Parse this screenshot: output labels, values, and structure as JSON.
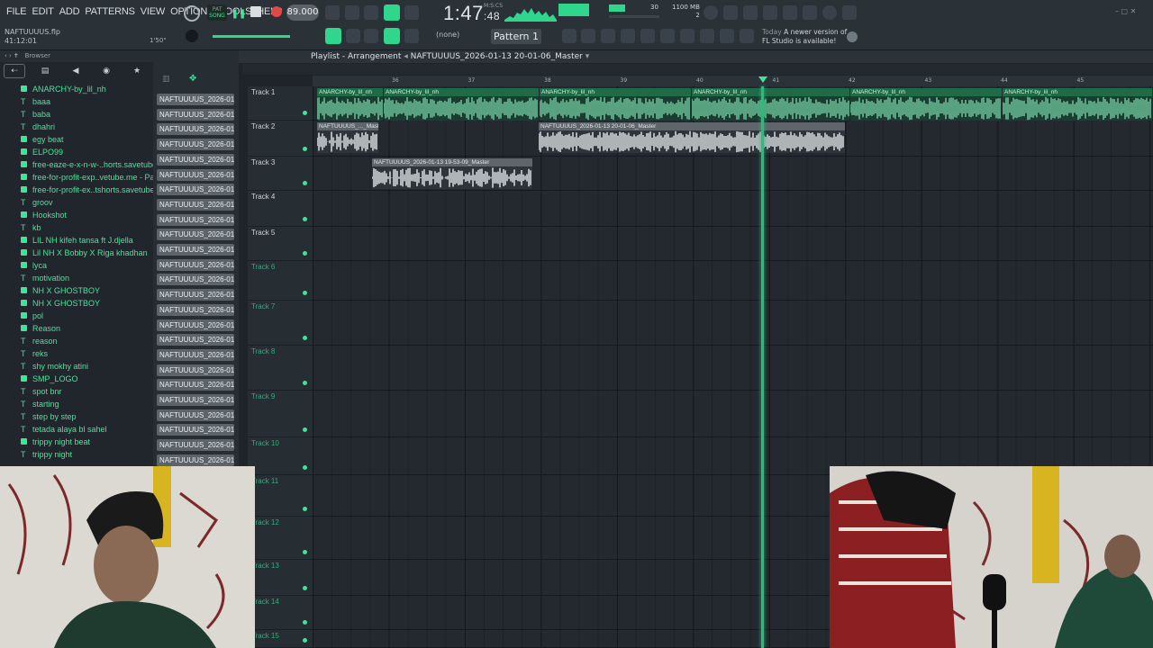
{
  "menu": [
    "FILE",
    "EDIT",
    "ADD",
    "PATTERNS",
    "VIEW",
    "OPTIONS",
    "TOOLS",
    "HELP"
  ],
  "project": {
    "filename": "NAFTUUUUS.flp",
    "time": "41:12:01",
    "zoom": "1'50\""
  },
  "transport": {
    "mode_label": "SONG",
    "tempo": "89.000",
    "time_main": "1:47",
    "time_sub": "48",
    "time_unit": "M:S:CS"
  },
  "cpu": {
    "memory": "1100 MB",
    "polyphony": "2",
    "cpu_value": "30"
  },
  "pattern": {
    "channel": "(none)",
    "name": "Pattern 1"
  },
  "news": {
    "when": "Today",
    "message_line1": "A newer version of",
    "message_line2": "FL Studio is available!"
  },
  "browser": {
    "title": "Browser",
    "items": [
      {
        "label": "ANARCHY-by_lil_nh",
        "type": "folder"
      },
      {
        "label": "baaa",
        "type": "text"
      },
      {
        "label": "baba",
        "type": "text"
      },
      {
        "label": "dhahri",
        "type": "text"
      },
      {
        "label": "egy beat",
        "type": "folder"
      },
      {
        "label": "ELPO99",
        "type": "folder"
      },
      {
        "label": "free-eaze-e-x-n-w-..horts.savetube.me",
        "type": "folder"
      },
      {
        "label": "free-for-profit-exp..vetube.me - Part_2",
        "type": "folder"
      },
      {
        "label": "free-for-profit-ex..tshorts.savetube.me",
        "type": "folder"
      },
      {
        "label": "groov",
        "type": "text"
      },
      {
        "label": "Hookshot",
        "type": "folder"
      },
      {
        "label": "kb",
        "type": "text"
      },
      {
        "label": "LIL NH kifeh tansa ft J.djella",
        "type": "folder"
      },
      {
        "label": "Lil NH X Bobby X Riga khadhan",
        "type": "folder"
      },
      {
        "label": "lyca",
        "type": "folder"
      },
      {
        "label": "motivation",
        "type": "text"
      },
      {
        "label": "NH X GHOSTBOY",
        "type": "folder"
      },
      {
        "label": "NH X GHOSTBOY",
        "type": "folder"
      },
      {
        "label": "pol",
        "type": "folder"
      },
      {
        "label": "Reason",
        "type": "folder"
      },
      {
        "label": "reason",
        "type": "text"
      },
      {
        "label": "reks",
        "type": "text"
      },
      {
        "label": "shy mokhy atini",
        "type": "text"
      },
      {
        "label": "SMP_LOGO",
        "type": "folder"
      },
      {
        "label": "spot bnr",
        "type": "text"
      },
      {
        "label": "starting",
        "type": "text"
      },
      {
        "label": "step by step",
        "type": "text"
      },
      {
        "label": "tetada alaya bl sahel",
        "type": "text"
      },
      {
        "label": "trippy night beat",
        "type": "folder"
      },
      {
        "label": "trippy night",
        "type": "text"
      }
    ]
  },
  "picker": {
    "item_label": "NAFTUUUUS_2026-01-13..."
  },
  "playlist": {
    "title": "Playlist - Arrangement",
    "arrangement": "NAFTUUUUS_2026-01-13 20-01-06_Master",
    "ruler": [
      "36",
      "37",
      "38",
      "39",
      "40",
      "41",
      "42",
      "43",
      "44",
      "45"
    ],
    "tracks": [
      "Track 1",
      "Track 2",
      "Track 3",
      "Track 4",
      "Track 5",
      "Track 6",
      "Track 7",
      "Track 8",
      "Track 9",
      "Track 10",
      "Track 11",
      "Track 12",
      "Track 13",
      "Track 14",
      "Track 15"
    ],
    "clips": {
      "anarchy": "ANARCHY-by_lil_nh",
      "t2a": "NAFTUUUUS_..._Master",
      "t2b": "NAFTUUUUS_2026-01-13 20-01-06_Master",
      "t3": "NAFTUUUUS_2026-01-13 19-53-09_Master"
    }
  },
  "colors": {
    "accent": "#3fe39a",
    "clip_green": "#1f5a40",
    "clip_gray": "#5e666b",
    "bg": "#1e2429"
  }
}
